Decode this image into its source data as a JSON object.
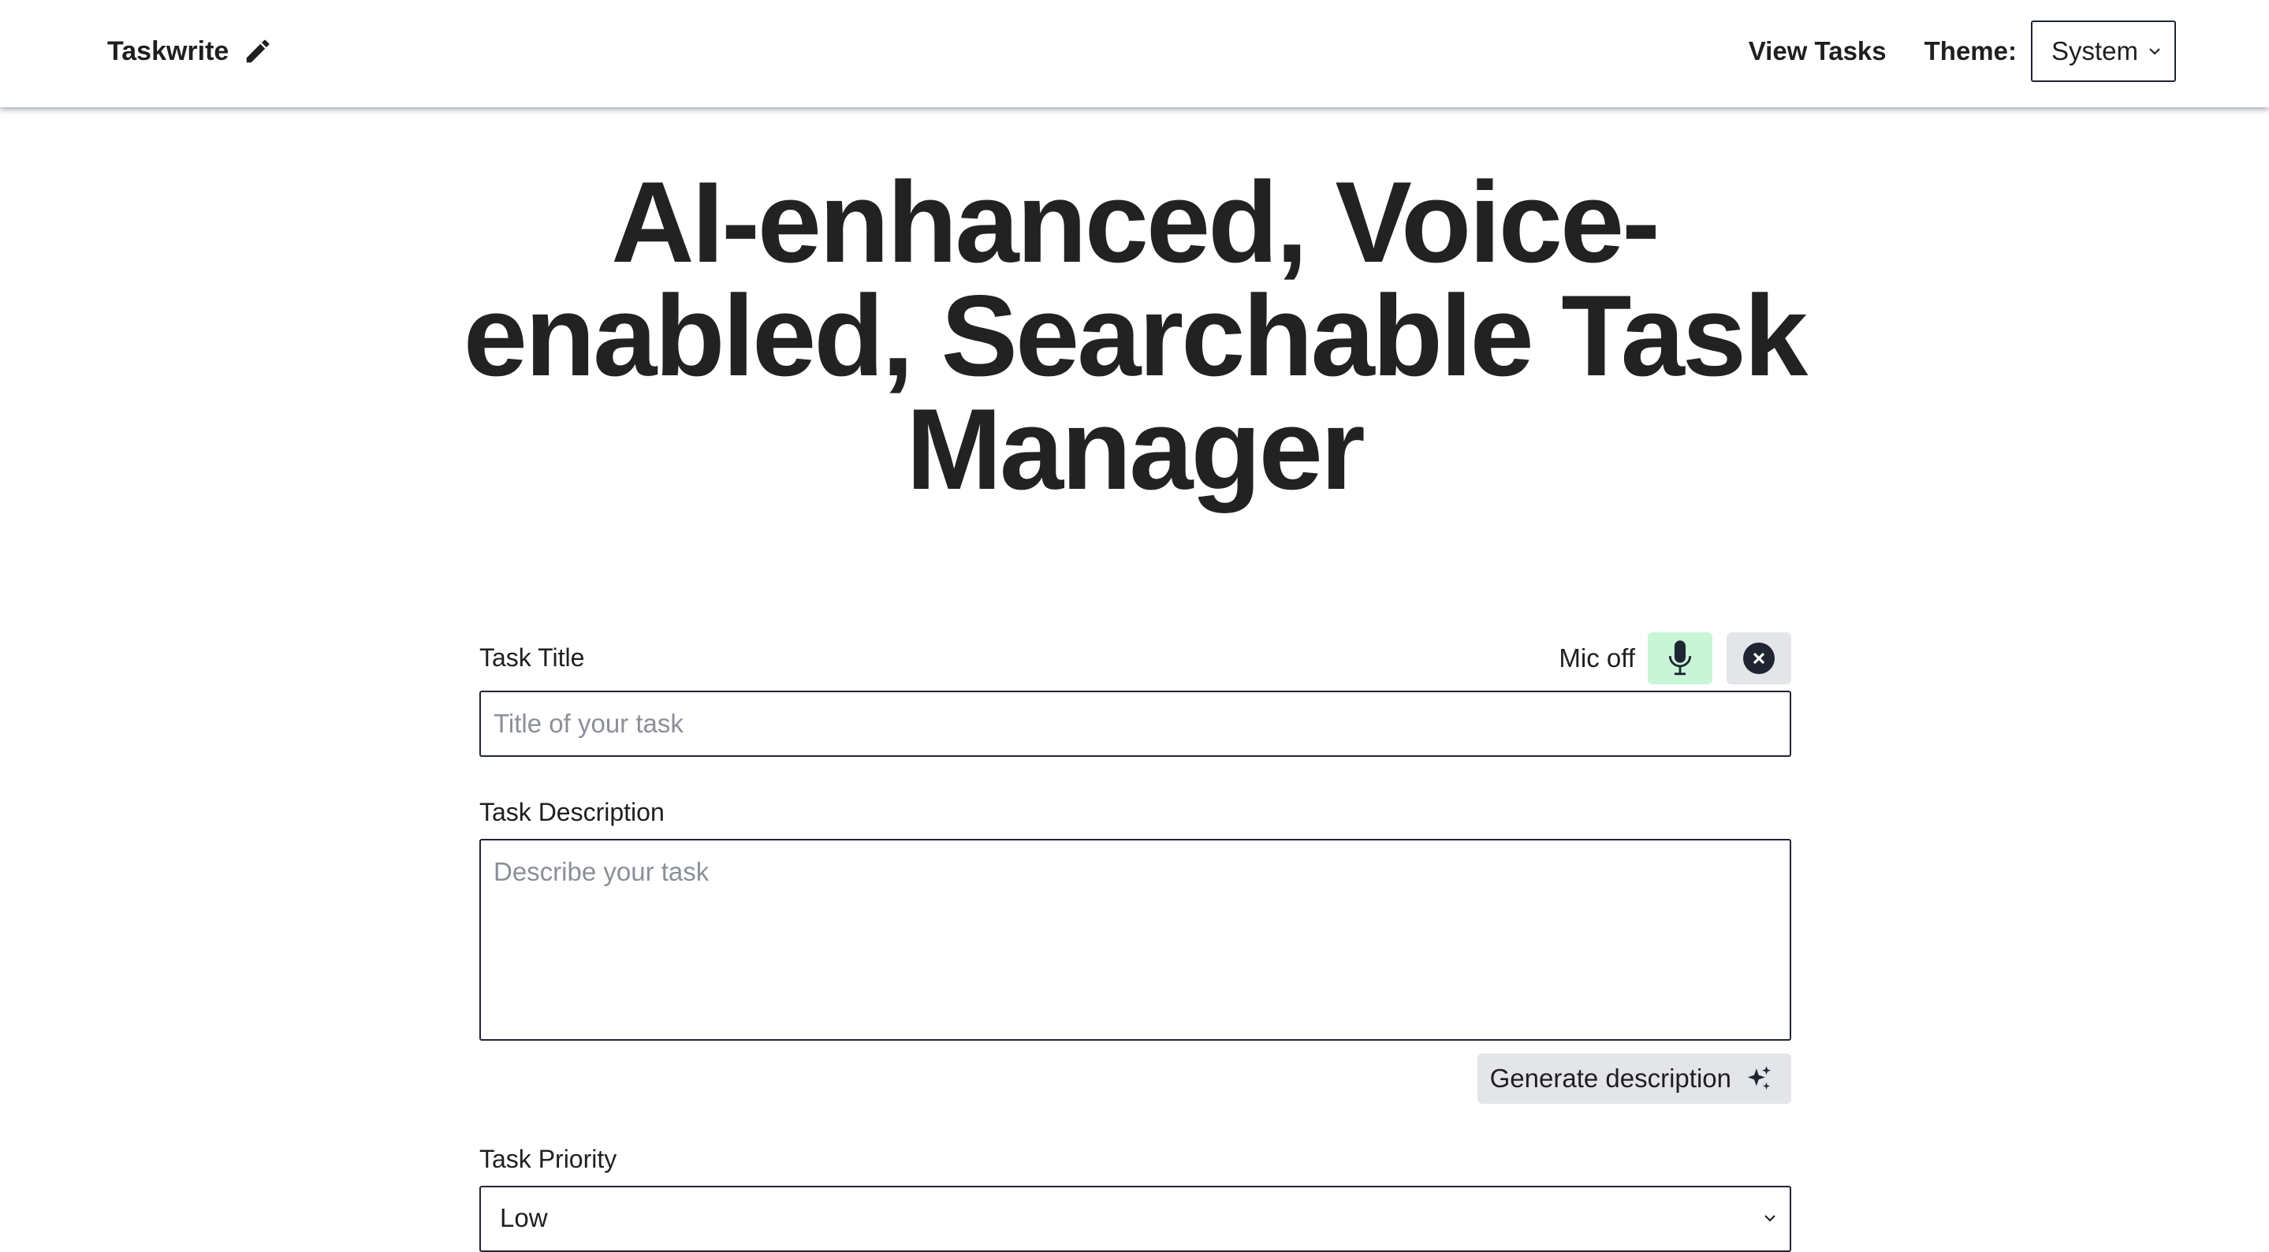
{
  "header": {
    "brand": "Taskwrite",
    "brand_icon": "pencil-icon",
    "nav_link": "View Tasks",
    "theme_label": "Theme:",
    "theme_value": "System"
  },
  "hero": {
    "title": "AI-enhanced, Voice-enabled, Searchable Task Manager"
  },
  "form": {
    "title_label": "Task Title",
    "mic_status": "Mic off",
    "mic_icon": "microphone-icon",
    "clear_icon": "close-circle-icon",
    "title_placeholder": "Title of your task",
    "description_label": "Task Description",
    "description_placeholder": "Describe your task",
    "generate_label": "Generate description",
    "generate_icon": "sparkle-icon",
    "priority_label": "Task Priority",
    "priority_value": "Low"
  },
  "colors": {
    "mic_button_bg": "#c8f5d6",
    "secondary_button_bg": "#e3e5e9",
    "border": "#1f2533",
    "text": "#1f1f1f",
    "placeholder": "#8a8f98"
  }
}
